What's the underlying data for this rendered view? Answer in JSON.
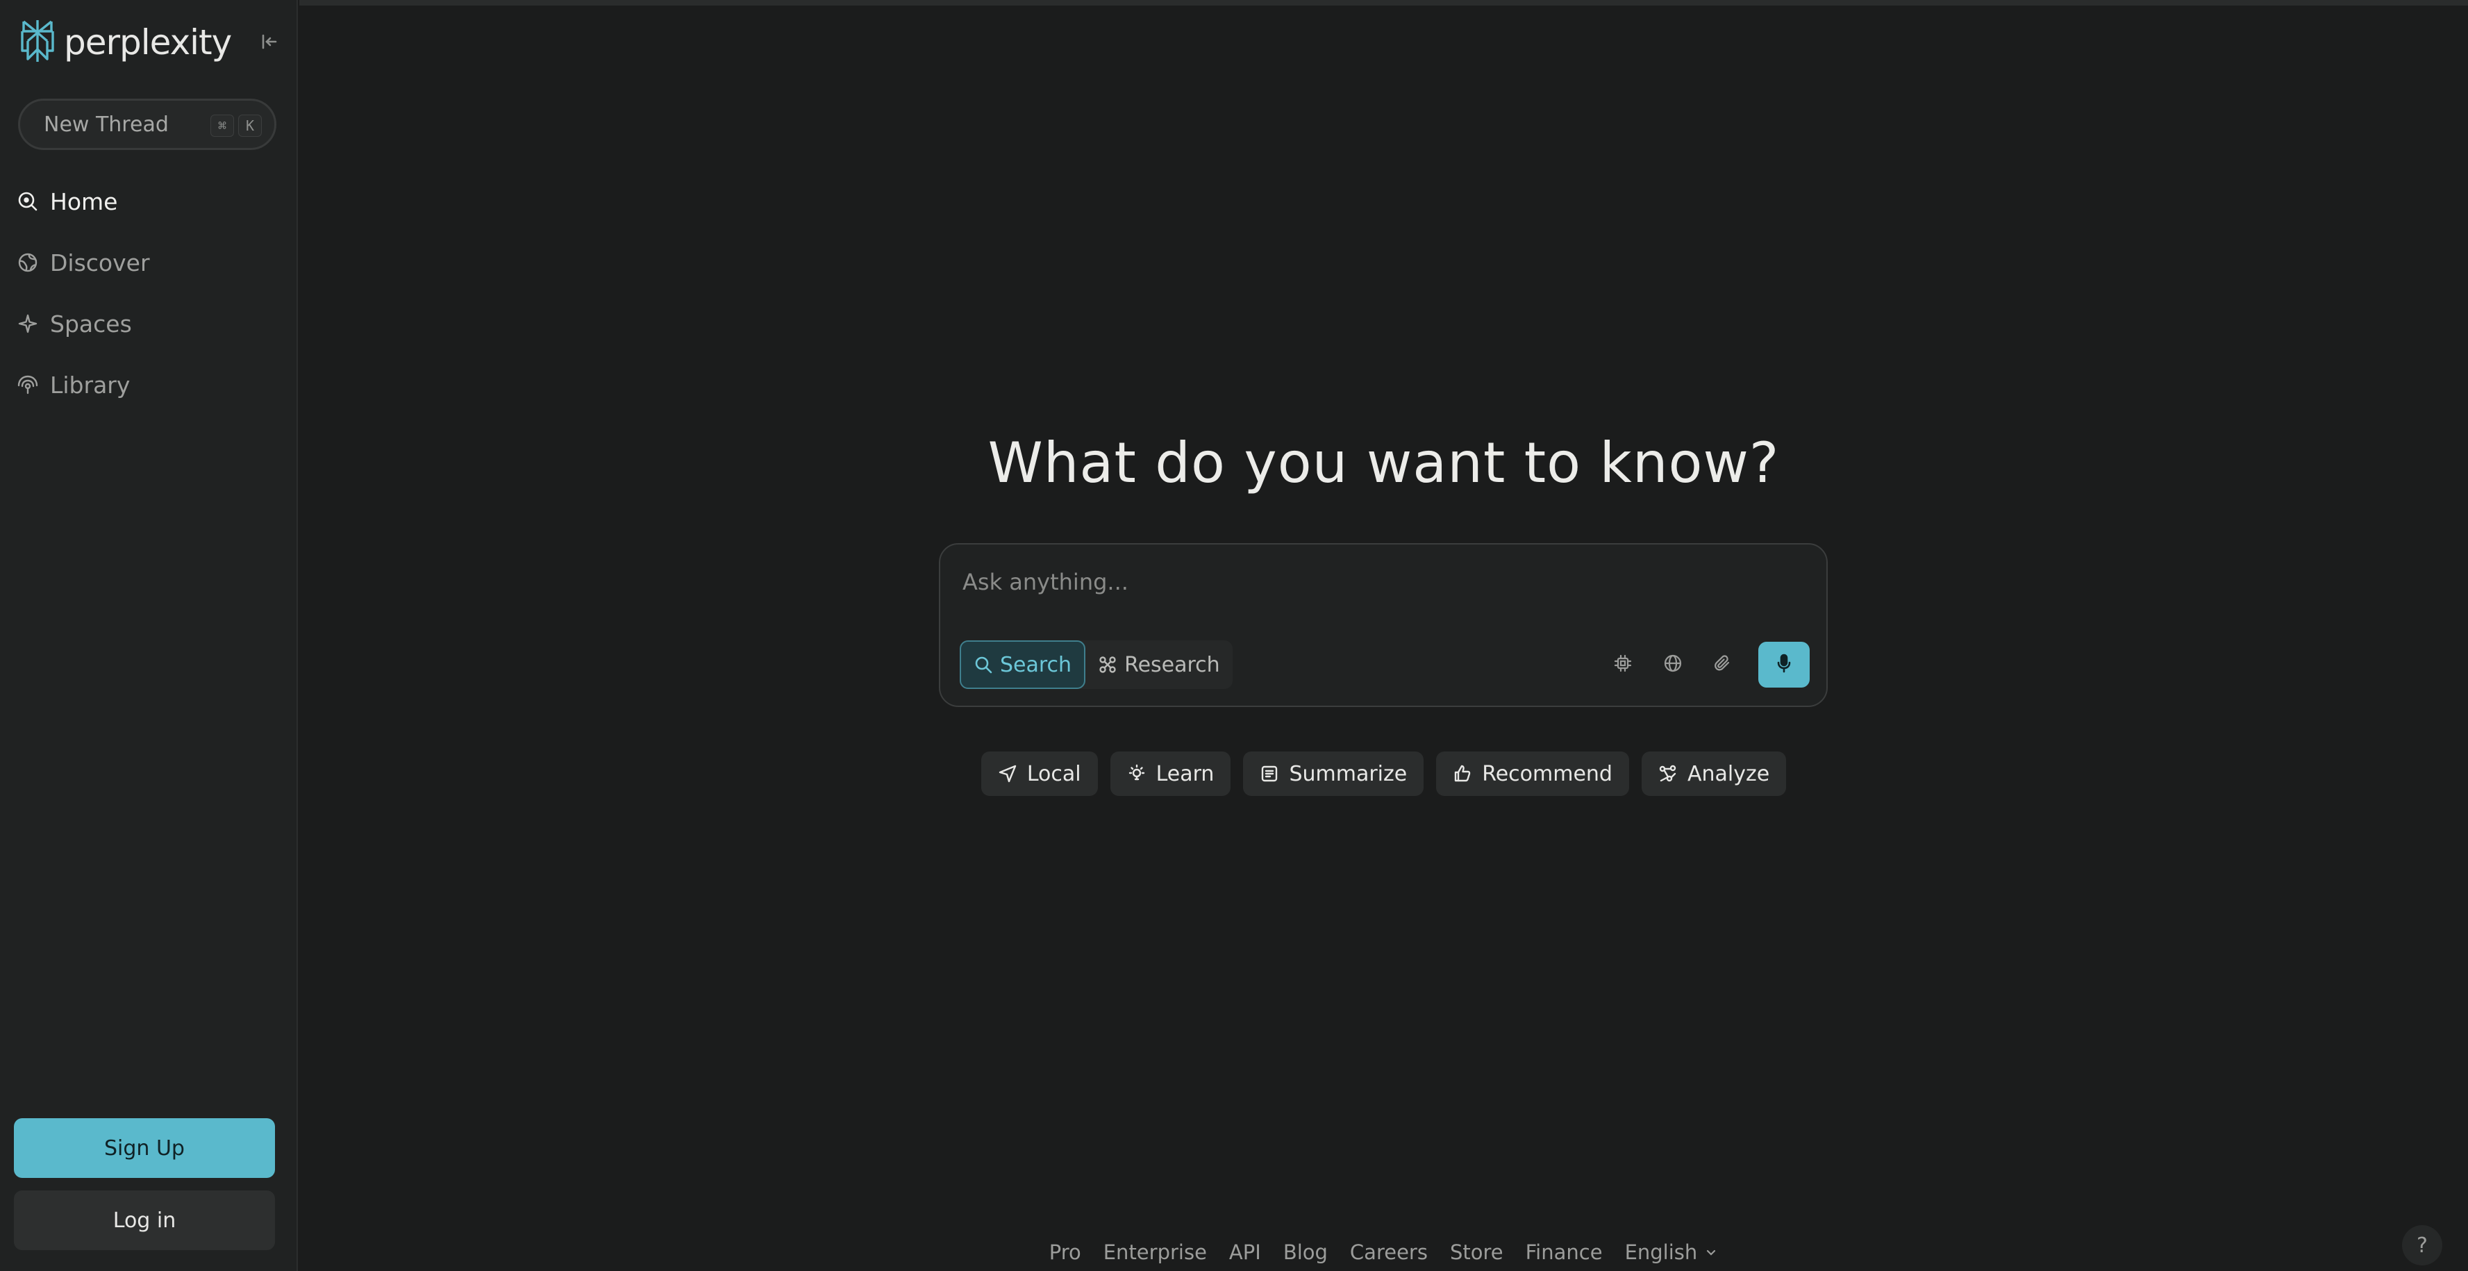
{
  "brand": {
    "name": "perplexity",
    "accent": "#5ab9cc"
  },
  "sidebar": {
    "new_thread": {
      "label": "New Thread",
      "shortcut": [
        "⌘",
        "K"
      ]
    },
    "items": [
      {
        "label": "Home",
        "icon": "home-search-icon",
        "active": true
      },
      {
        "label": "Discover",
        "icon": "globe-icon",
        "active": false
      },
      {
        "label": "Spaces",
        "icon": "sparkle-icon",
        "active": false
      },
      {
        "label": "Library",
        "icon": "library-icon",
        "active": false
      }
    ],
    "signup_label": "Sign Up",
    "login_label": "Log in"
  },
  "main": {
    "headline": "What do you want to know?",
    "search": {
      "placeholder": "Ask anything...",
      "modes": [
        {
          "label": "Search",
          "icon": "search-icon",
          "active": true
        },
        {
          "label": "Research",
          "icon": "research-icon",
          "active": false
        }
      ],
      "tools": [
        "cpu-chip-icon",
        "globe-icon",
        "paperclip-icon",
        "microphone-icon"
      ]
    },
    "chips": [
      {
        "label": "Local",
        "icon": "send-arrow-icon"
      },
      {
        "label": "Learn",
        "icon": "lightbulb-icon"
      },
      {
        "label": "Summarize",
        "icon": "document-lines-icon"
      },
      {
        "label": "Recommend",
        "icon": "thumbs-up-icon"
      },
      {
        "label": "Analyze",
        "icon": "analyze-nodes-icon"
      }
    ]
  },
  "footer": {
    "links": [
      "Pro",
      "Enterprise",
      "API",
      "Blog",
      "Careers",
      "Store",
      "Finance",
      "English"
    ],
    "help_label": "?"
  }
}
